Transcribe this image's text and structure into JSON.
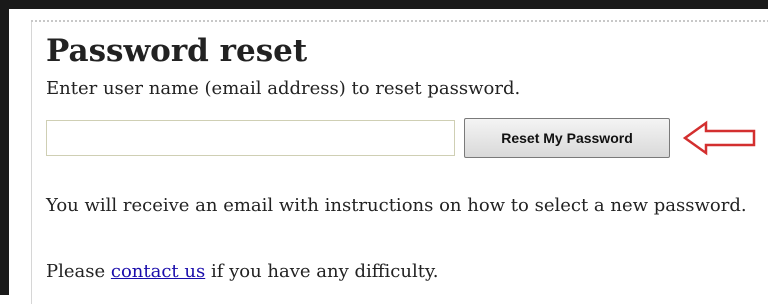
{
  "page": {
    "title": "Password reset",
    "subtitle": "Enter user name (email address) to reset password."
  },
  "form": {
    "email_value": "",
    "email_placeholder": "",
    "submit_label": "Reset My Password"
  },
  "annotation": {
    "arrow_icon": "left-arrow-icon",
    "arrow_color": "#d32f2f"
  },
  "info": {
    "instructions": "You will receive an email with instructions on how to select a new password.",
    "contact_prefix": "Please ",
    "contact_link": "contact us",
    "contact_suffix": " if you have any difficulty."
  }
}
